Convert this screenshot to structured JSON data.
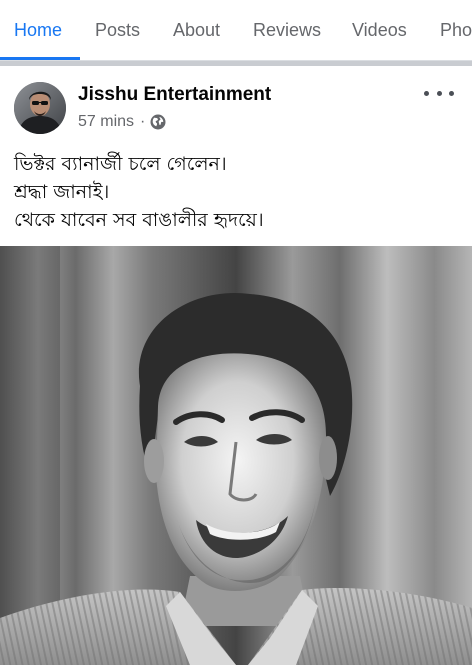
{
  "tabs": [
    {
      "label": "Home",
      "active": true
    },
    {
      "label": "Posts",
      "active": false
    },
    {
      "label": "About",
      "active": false
    },
    {
      "label": "Reviews",
      "active": false
    },
    {
      "label": "Videos",
      "active": false
    },
    {
      "label": "Pho",
      "active": false
    }
  ],
  "post": {
    "author": "Jisshu Entertainment",
    "time": "57 mins",
    "separator": "·",
    "privacy_icon": "globe-icon",
    "menu_icon": "more-options-icon",
    "lines": [
      "ভিক্টর ব্যানার্জী চলে গেলেন।",
      "শ্রদ্ধা জানাই।",
      "থেকে যাবেন সব বাঙালীর হৃদয়ে।"
    ],
    "photo_style": "black-and-white portrait"
  },
  "colors": {
    "accent": "#1877f2",
    "tab_text": "#65676b",
    "text": "#050505",
    "divider": "#c9ccd1"
  }
}
